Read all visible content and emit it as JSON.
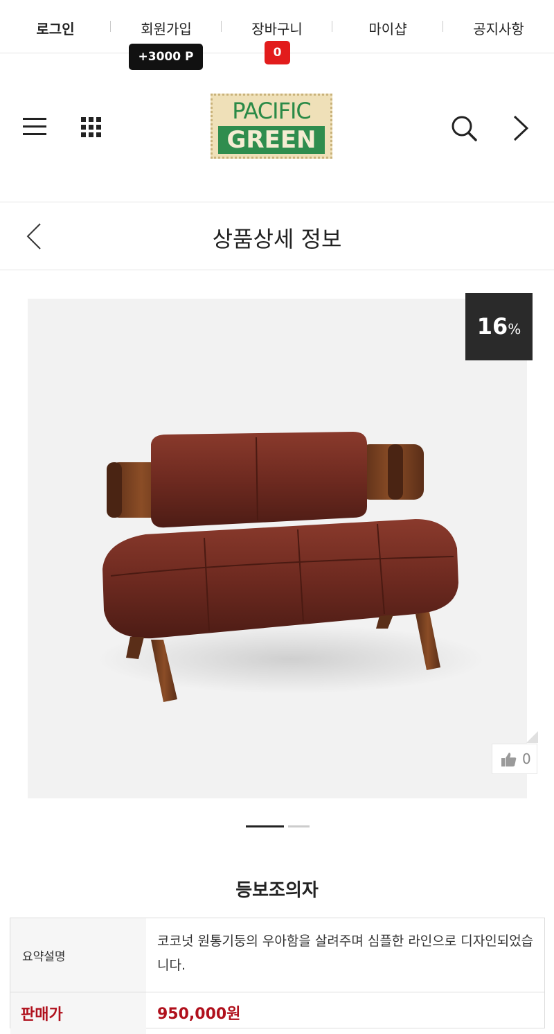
{
  "topnav": {
    "items": [
      {
        "label": "로그인"
      },
      {
        "label": "회원가입"
      },
      {
        "label": "장바구니"
      },
      {
        "label": "마이샵"
      },
      {
        "label": "공지사항"
      }
    ],
    "points_badge": "+3000 P",
    "cart_count": "0"
  },
  "header": {
    "logo_line1": "PACIFIC",
    "logo_line2": "GREEN",
    "icons": [
      "menu-icon",
      "grid-icon",
      "search-icon",
      "chevron-right-icon"
    ]
  },
  "page": {
    "title": "상품상세 정보",
    "back_icon": "chevron-left-icon"
  },
  "product": {
    "discount_number": "16",
    "discount_unit": "%",
    "like_count": "0",
    "name": "등보조의자",
    "summary_label": "요약설명",
    "summary_text": "코코넛 원통기둥의 우아함을 살려주며 심플한 라인으로 디자인되었습니다.",
    "price_label": "판매가",
    "price_value": "950,000원"
  },
  "gallery": {
    "current_slide": 1,
    "total_slides": 2
  },
  "colors": {
    "price": "#b0101c",
    "cart_badge": "#e21c1c",
    "discount_badge": "#2a2a2a"
  }
}
